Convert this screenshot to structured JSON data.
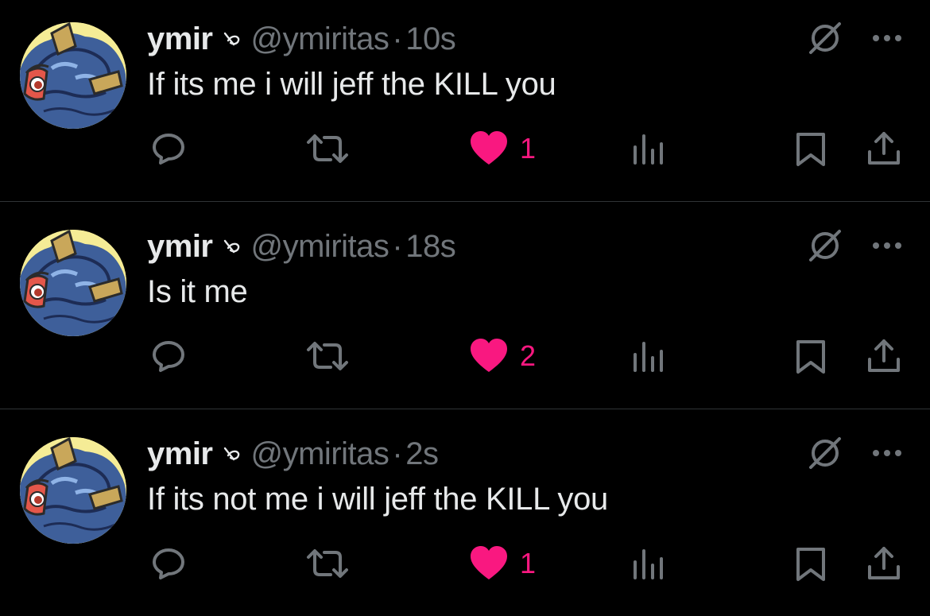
{
  "colors": {
    "background": "#000000",
    "text_primary": "#e7e9ea",
    "text_secondary": "#71767b",
    "like_active": "#f91880",
    "divider": "#2f3336"
  },
  "icons": {
    "badge": "affiliate-badge-icon",
    "grok": "grok-icon",
    "more": "more-icon",
    "reply": "reply-icon",
    "retweet": "retweet-icon",
    "like": "heart-filled-icon",
    "views": "views-icon",
    "bookmark": "bookmark-icon",
    "share": "share-icon"
  },
  "tweets": [
    {
      "display_name": "ymir",
      "handle": "@ymiritas",
      "separator": "·",
      "time": "10s",
      "text": "If its me i will jeff the KILL you",
      "like_count": "1"
    },
    {
      "display_name": "ymir",
      "handle": "@ymiritas",
      "separator": "·",
      "time": "18s",
      "text": "Is it me",
      "like_count": "2"
    },
    {
      "display_name": "ymir",
      "handle": "@ymiritas",
      "separator": "·",
      "time": "2s",
      "text": "If its not me i will jeff the KILL you",
      "like_count": "1"
    }
  ]
}
